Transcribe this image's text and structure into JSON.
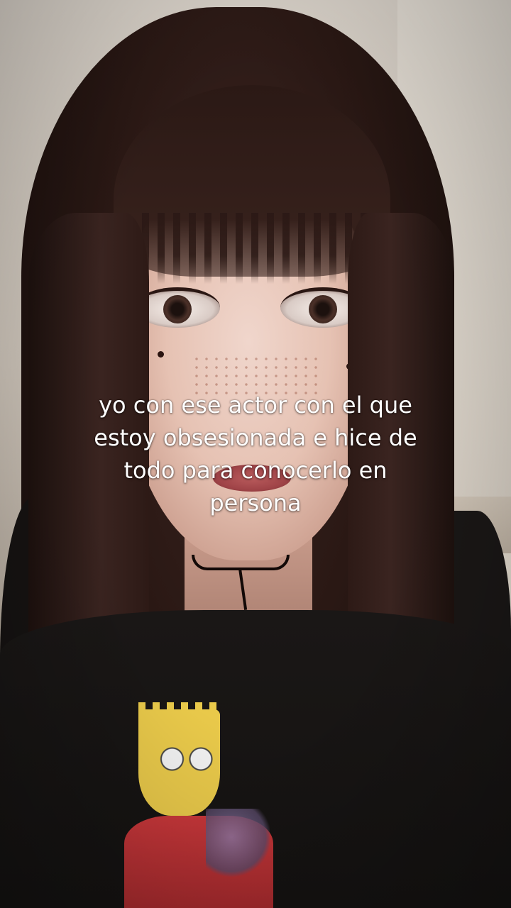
{
  "caption": {
    "text": "yo con ese actor con el que\nestoy obsesionada e hice de\ntodo para conocerlo en\npersona"
  },
  "colors": {
    "caption_text": "#ffffff",
    "hair": "#2b1915",
    "wall": "#d9d2c9",
    "shirt": "#1a1716",
    "print_yellow": "#e9c94a",
    "print_red": "#c8373a"
  }
}
